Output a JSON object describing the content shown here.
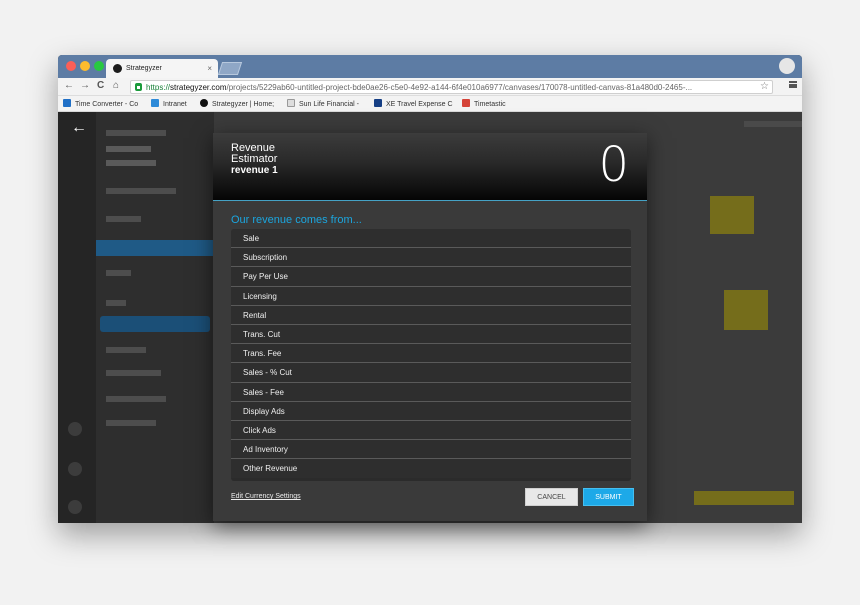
{
  "browser": {
    "tab_title": "Strategyzer",
    "tab_close": "×",
    "url_https": "https://",
    "url_domain": "strategyzer.com",
    "url_path": "/projects/5229ab60-untitled-project-bde0ae26-c5e0-4e92-a144-6f4e010a6977/canvases/170078-untitled-canvas-81a480d0-2465-...",
    "nav_back": "←",
    "nav_forward": "→",
    "nav_refresh": "C",
    "nav_home": "⌂",
    "star": "☆"
  },
  "bookmarks": [
    {
      "label": "Time Converter - Co",
      "icon": "time-icon",
      "color": "#1f6fc6"
    },
    {
      "label": "Intranet",
      "icon": "intranet-icon",
      "color": "#2d8ad8"
    },
    {
      "label": "Strategyzer | Home;",
      "icon": "strategyzer-icon",
      "color": "#111111"
    },
    {
      "label": "Sun Life Financial - ",
      "icon": "document-icon",
      "color": "#cccccc"
    },
    {
      "label": "XE Travel Expense C",
      "icon": "xe-icon",
      "color": "#163f85"
    },
    {
      "label": "Timetastic",
      "icon": "calendar-icon",
      "color": "#d54338"
    }
  ],
  "modal": {
    "title": "Revenue Estimator",
    "subtitle": "revenue 1",
    "total": "0",
    "section_label": "Our revenue comes from...",
    "options": [
      "Sale",
      "Subscription",
      "Pay Per Use",
      "Licensing",
      "Rental",
      "Trans. Cut",
      "Trans. Fee",
      "Sales - % Cut",
      "Sales - Fee",
      "Display Ads",
      "Click Ads",
      "Ad Inventory",
      "Other Revenue"
    ],
    "edit_currency_link": "Edit Currency Settings",
    "cancel_label": "CANCEL",
    "submit_label": "SUBMIT"
  },
  "colors": {
    "accent": "#1da9e8",
    "section_label": "#1ba6df",
    "header_border": "#45a2c5"
  }
}
